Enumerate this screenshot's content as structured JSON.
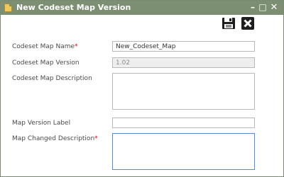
{
  "window": {
    "title": "New Codeset Map Version",
    "controls": [
      "minimize",
      "maximize",
      "close"
    ]
  },
  "toolbar": {
    "icons": [
      "save-icon",
      "delete-icon"
    ]
  },
  "form": {
    "name_label": "Codeset Map Name",
    "name_value": "New_Codeset_Map",
    "version_label": "Codeset Map Version",
    "version_value": "1.02",
    "description_label": "Codeset Map Description",
    "description_value": "",
    "version_label_label": "Map Version Label",
    "version_label_value": "",
    "changed_description_label": "Map Changed Description",
    "changed_description_value": "",
    "required_marker": "*"
  },
  "colors": {
    "titlebar": "#7d8f72",
    "required": "#d40000",
    "focus_border": "#4f8fd6"
  }
}
